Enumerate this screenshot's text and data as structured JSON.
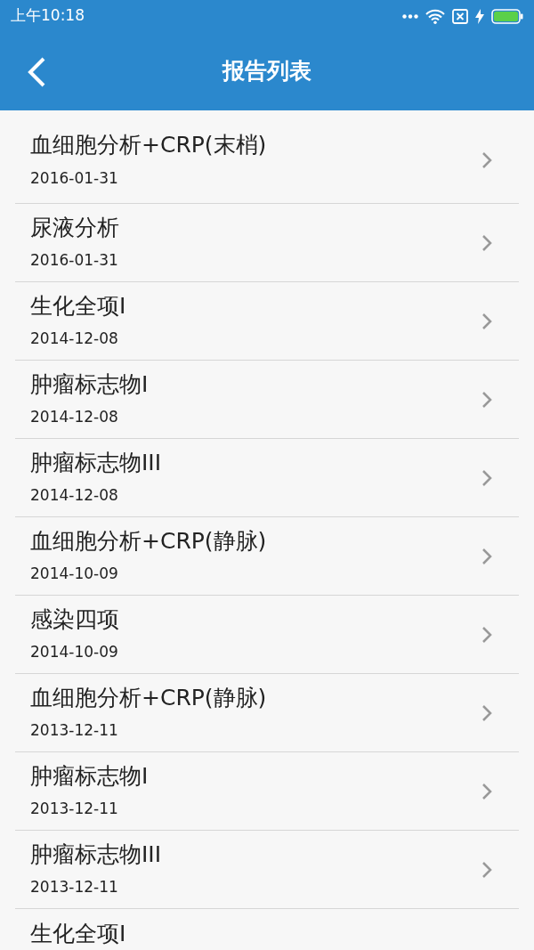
{
  "status_bar": {
    "time": "上午10:18"
  },
  "header": {
    "title": "报告列表"
  },
  "reports": [
    {
      "name": "血细胞分析+CRP(末梢)",
      "date": "2016-01-31"
    },
    {
      "name": "尿液分析",
      "date": "2016-01-31"
    },
    {
      "name": "生化全项I",
      "date": "2014-12-08"
    },
    {
      "name": "肿瘤标志物I",
      "date": "2014-12-08"
    },
    {
      "name": "肿瘤标志物III",
      "date": "2014-12-08"
    },
    {
      "name": "血细胞分析+CRP(静脉)",
      "date": "2014-10-09"
    },
    {
      "name": "感染四项",
      "date": "2014-10-09"
    },
    {
      "name": "血细胞分析+CRP(静脉)",
      "date": "2013-12-11"
    },
    {
      "name": "肿瘤标志物I",
      "date": "2013-12-11"
    },
    {
      "name": "肿瘤标志物III",
      "date": "2013-12-11"
    },
    {
      "name": "生化全项I"
    }
  ]
}
